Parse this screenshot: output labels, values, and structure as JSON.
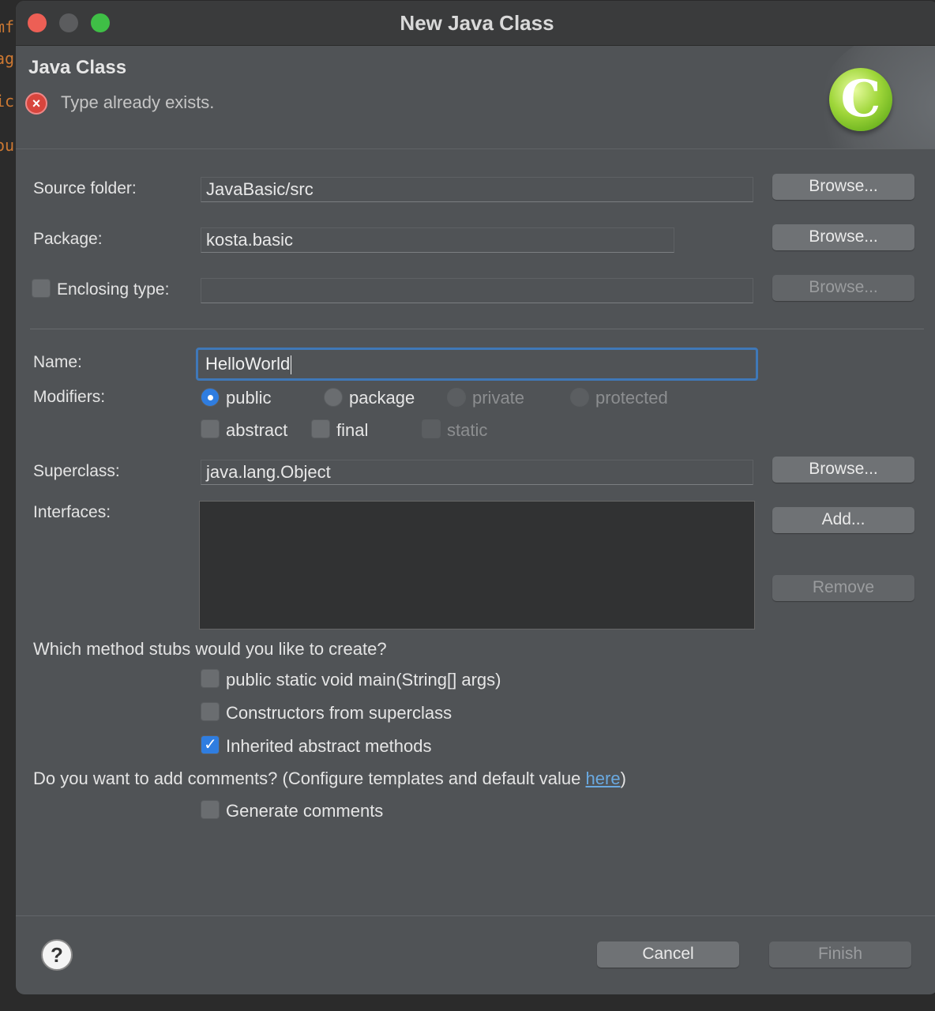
{
  "background": {
    "editor_fragments": [
      "mf",
      "ag",
      "ic",
      "ou"
    ]
  },
  "window": {
    "title": "New Java Class"
  },
  "header": {
    "title": "Java Class",
    "error_message": "Type already exists.",
    "error_icon": "error-x-icon",
    "banner_icon": "java-class-c-icon",
    "banner_icon_letter": "C"
  },
  "form": {
    "source_folder": {
      "label": "Source folder:",
      "value": "JavaBasic/src",
      "browse": "Browse..."
    },
    "package": {
      "label": "Package:",
      "value": "kosta.basic",
      "browse": "Browse..."
    },
    "enclosing_type": {
      "label": "Enclosing type:",
      "checked": false,
      "value": "",
      "browse": "Browse..."
    },
    "name": {
      "label": "Name:",
      "value": "HelloWorld"
    },
    "modifiers": {
      "label": "Modifiers:",
      "access": [
        {
          "label": "public",
          "selected": true,
          "enabled": true
        },
        {
          "label": "package",
          "selected": false,
          "enabled": true
        },
        {
          "label": "private",
          "selected": false,
          "enabled": false
        },
        {
          "label": "protected",
          "selected": false,
          "enabled": false
        }
      ],
      "flags": [
        {
          "label": "abstract",
          "checked": false,
          "enabled": true
        },
        {
          "label": "final",
          "checked": false,
          "enabled": true
        },
        {
          "label": "static",
          "checked": false,
          "enabled": false
        }
      ]
    },
    "superclass": {
      "label": "Superclass:",
      "value": "java.lang.Object",
      "browse": "Browse..."
    },
    "interfaces": {
      "label": "Interfaces:",
      "add": "Add...",
      "remove": "Remove"
    }
  },
  "stubs": {
    "question": "Which method stubs would you like to create?",
    "options": [
      {
        "label": "public static void main(String[] args)",
        "checked": false
      },
      {
        "label": "Constructors from superclass",
        "checked": false
      },
      {
        "label": "Inherited abstract methods",
        "checked": true
      }
    ]
  },
  "comments": {
    "question_prefix": "Do you want to add comments? (Configure templates and default value ",
    "link_text": "here",
    "question_suffix": ")",
    "generate_label": "Generate comments",
    "generate_checked": false
  },
  "footer": {
    "help_icon": "help-question-icon",
    "help_glyph": "?",
    "cancel": "Cancel",
    "finish": "Finish"
  },
  "colors": {
    "dialog_bg": "#505356",
    "accent": "#2f7de0",
    "focus_border": "#3f78b8",
    "error": "#d8453d",
    "link": "#6aa9e0"
  }
}
